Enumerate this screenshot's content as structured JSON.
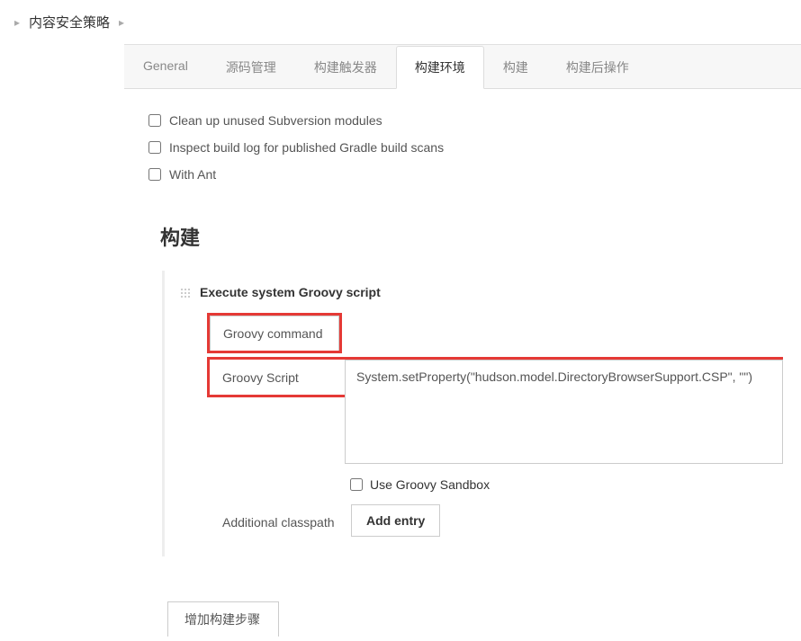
{
  "breadcrumb": {
    "title": "内容安全策略"
  },
  "tabs": {
    "general": "General",
    "source": "源码管理",
    "trigger": "构建触发器",
    "env": "构建环境",
    "build": "构建",
    "post": "构建后操作",
    "active_index": 3
  },
  "buildEnv": {
    "cleanSvn": "Clean up unused Subversion modules",
    "inspectGradle": "Inspect build log for published Gradle build scans",
    "withAnt": "With Ant"
  },
  "buildSection": {
    "title": "构建",
    "stepTitle": "Execute system Groovy script",
    "groovyCommandTab": "Groovy command",
    "groovyScriptLabel": "Groovy Script",
    "groovyScriptValue": "System.setProperty(\"hudson.model.DirectoryBrowserSupport.CSP\", \"\")",
    "sandboxLabel": "Use Groovy Sandbox",
    "classpathLabel": "Additional classpath",
    "addEntryBtn": "Add entry",
    "addStepBtn": "增加构建步骤"
  }
}
